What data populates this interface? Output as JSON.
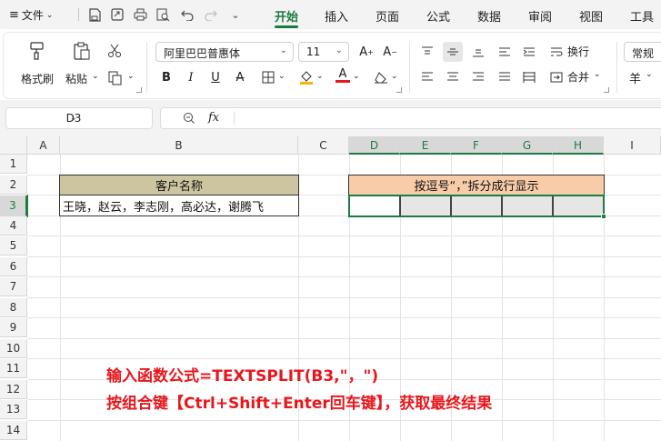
{
  "menu": {
    "file_label": "文件",
    "tabs": [
      "开始",
      "插入",
      "页面",
      "公式",
      "数据",
      "审阅",
      "视图",
      "工具"
    ],
    "active_tab": "开始"
  },
  "ribbon": {
    "format_painter": "格式刷",
    "paste": "粘贴",
    "font_name": "阿里巴巴普惠体",
    "font_size": "11",
    "wrap_text": "换行",
    "merge": "合并",
    "number_format": "常规",
    "currency_symbol": "羊"
  },
  "formula_bar": {
    "name_box": "D3",
    "fx_label": "fx",
    "formula": ""
  },
  "sheet": {
    "columns": [
      "A",
      "B",
      "C",
      "D",
      "E",
      "F",
      "G",
      "H",
      "I"
    ],
    "rows": [
      "1",
      "2",
      "3",
      "4",
      "5",
      "6",
      "7",
      "8",
      "9",
      "10",
      "11",
      "12",
      "13",
      "14"
    ],
    "b2": "客户名称",
    "b3": "王晓，赵云，李志刚，高必达，谢腾飞",
    "d2": "按逗号“，”拆分成行显示"
  },
  "note": {
    "line1": "输入函数公式=TEXTSPLIT(B3,\"，\")",
    "line2": "按组合键【Ctrl+Shift+Enter回车键】，获取最终结果"
  },
  "colors": {
    "accent": "#1e7b42",
    "header_b": "#cdc5a0",
    "header_d": "#f8cca8",
    "note": "#e8171c"
  }
}
